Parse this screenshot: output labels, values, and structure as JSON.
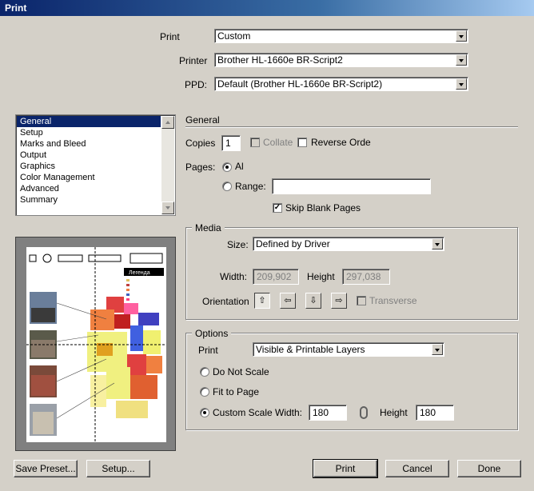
{
  "window": {
    "title": "Print"
  },
  "top": {
    "print_label": "Print",
    "print_value": "Custom",
    "printer_label": "Printer",
    "printer_value": "Brother HL-1660e BR-Script2",
    "ppd_label": "PPD:",
    "ppd_value": "Default (Brother HL-1660e BR-Script2)"
  },
  "sidebar": {
    "items": [
      {
        "label": "General",
        "selected": true
      },
      {
        "label": "Setup"
      },
      {
        "label": "Marks and Bleed"
      },
      {
        "label": "Output"
      },
      {
        "label": "Graphics"
      },
      {
        "label": "Color Management"
      },
      {
        "label": "Advanced"
      },
      {
        "label": "Summary"
      }
    ]
  },
  "preview": {
    "legend_title": "Легенда"
  },
  "general": {
    "section_title": "General",
    "copies_label": "Copies",
    "copies_value": "1",
    "collate_label": "Collate",
    "reverse_label": "Reverse Orde",
    "pages_label": "Pages:",
    "all_label": "Al",
    "range_label": "Range:",
    "range_value": "",
    "skip_blank_label": "Skip Blank Pages",
    "skip_blank_checked": true
  },
  "media": {
    "section_title": "Media",
    "size_label": "Size:",
    "size_value": "Defined by Driver",
    "width_label": "Width:",
    "width_value": "209,902",
    "height_label": "Height",
    "height_value": "297,038",
    "orientation_label": "Orientation",
    "transverse_label": "Transverse"
  },
  "options": {
    "section_title": "Options",
    "print_label": "Print",
    "print_value": "Visible & Printable Layers",
    "do_not_scale_label": "Do Not Scale",
    "fit_to_page_label": "Fit to Page",
    "custom_scale_label": "Custom Scale",
    "width_label": "Width:",
    "width_value": "180",
    "height_label": "Height",
    "height_value": "180"
  },
  "buttons": {
    "save_preset": "Save Preset...",
    "setup": "Setup...",
    "print": "Print",
    "cancel": "Cancel",
    "done": "Done"
  }
}
